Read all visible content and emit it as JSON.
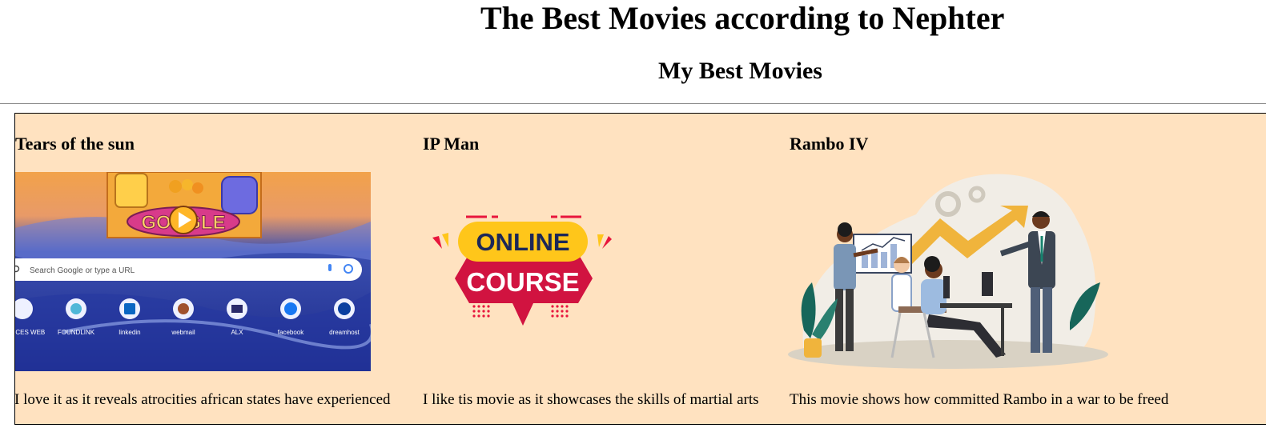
{
  "page": {
    "title": "The Best Movies according to Nephter",
    "section_title": "My Best Movies"
  },
  "movies": [
    {
      "title": "Tears of the sun",
      "description": "I love it as it reveals atrocities african states have experienced",
      "image": {
        "search_placeholder": "Search Google or type a URL",
        "doodle_text": "GOOGLE",
        "shortcuts": [
          "PICES WEB",
          "FOUNDLINK",
          "linkedin",
          "webmail",
          "ALX",
          "facebook",
          "dreamhost"
        ]
      }
    },
    {
      "title": "IP Man",
      "description": "I like tis movie as it showcases the skills of martial arts",
      "image": {
        "line1": "ONLINE",
        "line2": "COURSE"
      }
    },
    {
      "title": "Rambo IV",
      "description": "This movie shows how committed Rambo in a war to be freed",
      "image": {
        "icon": "business-presentation-illustration"
      }
    }
  ],
  "colors": {
    "table_background": "#ffe2c0",
    "course_yellow": "#ffc61a",
    "course_red": "#e8163c",
    "course_navy": "#1c2758"
  }
}
